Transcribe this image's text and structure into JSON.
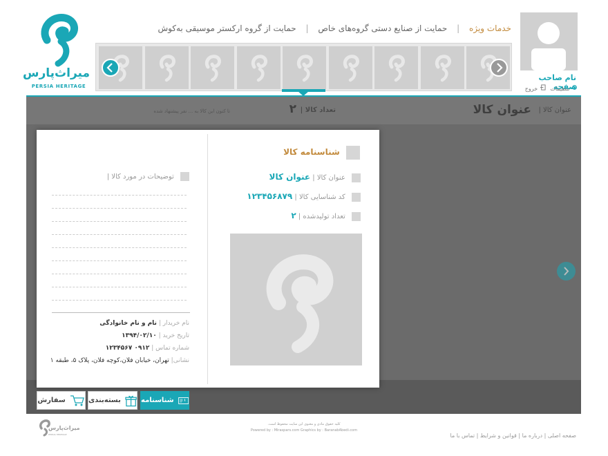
{
  "brand": {
    "name_fa": "میراث‌پارس",
    "name_en": "PERSIA HERITAGE",
    "color": "#1aa7b6"
  },
  "topnav": [
    {
      "label": "خدمات ویژه",
      "special": true
    },
    {
      "label": "حمایت از صنایع دستی گروه‌های خاص"
    },
    {
      "label": "حمایت از گروه ارکستر موسیقی به‌کوش"
    }
  ],
  "profile": {
    "name": "نام صاحب صفحه",
    "settings": "تنظیمات",
    "logout": "خروج"
  },
  "infobar": {
    "title_label": "عنوان کالا |",
    "title_value": "عنوان کالا",
    "count_label": "تعداد کالا |",
    "count_value": "۲",
    "note": "تا کنون این کالا به ... نفر پیشنهاد شده"
  },
  "certificate": {
    "heading": "شناسنامه کالا",
    "title_label": "عنوان کالا |",
    "title_value": "عنوان کالا",
    "code_label": "کد شناسایی کالا |",
    "code_value": "۱۲۳۴۵۶۸۷۹",
    "produced_label": "تعداد تولیدشده |",
    "produced_value": "۲"
  },
  "description": {
    "label": "توضیحات در مورد کالا |"
  },
  "buyer": {
    "name_label": "نام خریدار |",
    "name_value": "نام و نام خانوادگی",
    "date_label": "تاریخ خرید |",
    "date_value": "۱۳۹۴/۰۲/۱۰",
    "phone_label": "شماره تماس |",
    "phone_value": "۰۹۱۲ ۱۲۳۴۵۶۷",
    "address_label": "نشانی|",
    "address_value": "تهران، خیابان فلان،کوچه فلان، پلاک ۵، طبقه ۱"
  },
  "tabs": [
    {
      "label": "شناسنامه",
      "active": true
    },
    {
      "label": "بسته‌بندی",
      "active": false
    },
    {
      "label": "سفارش",
      "active": false
    }
  ],
  "footer": {
    "copyright": "کلیه حقوق مادی و معنوی این سایت محفوظ است.",
    "powered": "Powered by : Miraspars.com     Graphics by : BaranabAbedi.com",
    "links": "صفحه اصلی | درباره ما | قوانین و شرایط | تماس با ما"
  }
}
